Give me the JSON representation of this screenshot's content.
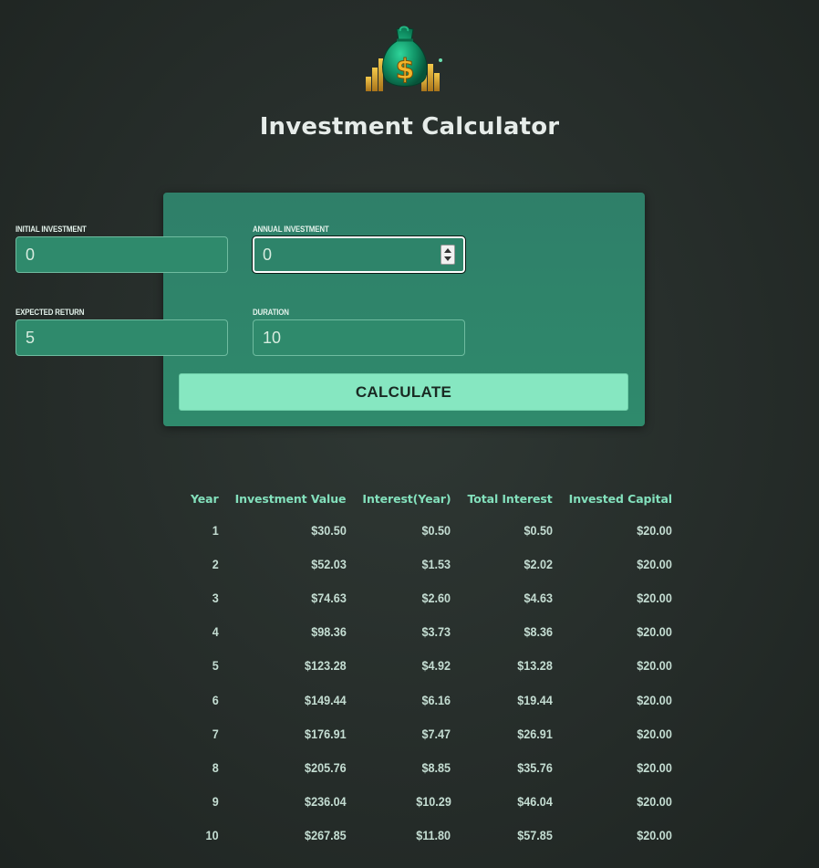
{
  "header": {
    "title": "Investment Calculator",
    "logo_icon": "money-bag-icon"
  },
  "user_input": {
    "initial_investment": {
      "label": "Initial Investment",
      "value": "0"
    },
    "annual_investment": {
      "label": "Annual Investment",
      "value": "0",
      "focused": true
    },
    "expected_return": {
      "label": "Expected Return",
      "value": "5"
    },
    "duration": {
      "label": "Duration",
      "value": "10"
    },
    "calculate_label": "CALCULATE"
  },
  "results": {
    "columns": [
      "Year",
      "Investment Value",
      "Interest(Year)",
      "Total Interest",
      "Invested Capital"
    ],
    "rows": [
      [
        "1",
        "$30.50",
        "$0.50",
        "$0.50",
        "$20.00"
      ],
      [
        "2",
        "$52.03",
        "$1.53",
        "$2.02",
        "$20.00"
      ],
      [
        "3",
        "$74.63",
        "$2.60",
        "$4.63",
        "$20.00"
      ],
      [
        "4",
        "$98.36",
        "$3.73",
        "$8.36",
        "$20.00"
      ],
      [
        "5",
        "$123.28",
        "$4.92",
        "$13.28",
        "$20.00"
      ],
      [
        "6",
        "$149.44",
        "$6.16",
        "$19.44",
        "$20.00"
      ],
      [
        "7",
        "$176.91",
        "$7.47",
        "$26.91",
        "$20.00"
      ],
      [
        "8",
        "$205.76",
        "$8.85",
        "$35.76",
        "$20.00"
      ],
      [
        "9",
        "$236.04",
        "$10.29",
        "$46.04",
        "$20.00"
      ],
      [
        "10",
        "$267.85",
        "$11.80",
        "$57.85",
        "$20.00"
      ]
    ]
  },
  "colors": {
    "background": "#262d2a",
    "panel": "#2f8a6c",
    "accent": "#86e7c1",
    "header_text": "#83e0bc"
  }
}
